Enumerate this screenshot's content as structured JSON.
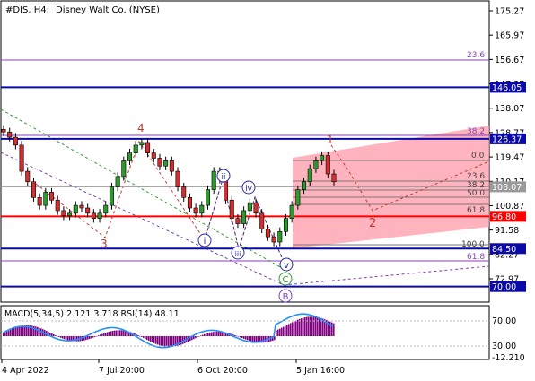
{
  "header": {
    "symbol": "#DIS, H4:",
    "name": "Disney Walt Co. (NYSE)"
  },
  "price_axis": {
    "ticks": [
      "175.27",
      "165.97",
      "156.67",
      "147.37",
      "138.07",
      "128.77",
      "119.47",
      "110.17",
      "100.87",
      "91.58",
      "82.27",
      "72.97"
    ]
  },
  "levels": [
    {
      "value": "146.05",
      "color": "#0a0aa8"
    },
    {
      "value": "126.37",
      "color": "#0a0aa8"
    },
    {
      "value": "108.07",
      "color": "#9a9a9a"
    },
    {
      "value": "96.80",
      "color": "#ff0000"
    },
    {
      "value": "84.50",
      "color": "#0a0aa8"
    },
    {
      "value": "70.00",
      "color": "#0a0aa8"
    }
  ],
  "fib_labels": {
    "top_236": "23.6",
    "left_382": "38.2",
    "f0": "0.0",
    "f236": "23.6",
    "f382": "38.2",
    "f50": "50.0",
    "f618": "61.8",
    "f100": "100.0",
    "f618b": "61.8"
  },
  "wave_labels": {
    "w4": "4",
    "w3": "3",
    "w1": "1",
    "w2": "2",
    "wi": "i",
    "wii": "ii",
    "wiii": "iii",
    "wiv": "iv",
    "wv": "v",
    "wC": "C",
    "wB": "B"
  },
  "indicator": {
    "title": "MACD(5,34,5) 2.121 3.718 RSI(14) 48.11",
    "ticks": [
      "70.00",
      "30.00",
      "-12.210"
    ],
    "macd_color": "#800080",
    "rsi_color": "#1e90ff"
  },
  "time_axis": {
    "ticks": [
      "4 Apr 2022",
      "7 Jul 20:00",
      "6 Oct 20:00",
      "5 Jan 16:00"
    ]
  },
  "chart_data": {
    "type": "line",
    "title": "#DIS, H4: Disney Walt Co. (NYSE)",
    "xlabel": "",
    "ylabel": "",
    "ylim": [
      68,
      178
    ],
    "x_ticks": [
      "4 Apr 2022",
      "7 Jul 20:00",
      "6 Oct 20:00",
      "5 Jan 16:00"
    ],
    "series": [
      {
        "name": "",
        "values": [
          129,
          127,
          124,
          114,
          110,
          104,
          101,
          106,
          103,
          99,
          97,
          98,
          101,
          100,
          98,
          96,
          98,
          101,
          108,
          112,
          118,
          121,
          124,
          125,
          121,
          119,
          116,
          118,
          114,
          108,
          104,
          100,
          98,
          101,
          107,
          114,
          111,
          103,
          96,
          94,
          99,
          102,
          98,
          92,
          89,
          87,
          91,
          96,
          101,
          107,
          110,
          115,
          118,
          120,
          113,
          110
        ]
      }
    ],
    "horizontal_levels": [
      146.05,
      126.37,
      108.07,
      96.8,
      84.5,
      70.0
    ],
    "fibonacci_levels": [
      "0.0",
      "23.6",
      "38.2",
      "50.0",
      "61.8",
      "100.0"
    ],
    "wave_labels": [
      "4",
      "3",
      "1",
      "2",
      "i",
      "ii",
      "iii",
      "iv",
      "v",
      "C",
      "B"
    ],
    "indicator": {
      "name": "MACD(5,34,5) RSI(14)",
      "macd_values": [
        2.121,
        3.718
      ],
      "rsi": 48.11,
      "ticks": [
        70.0,
        30.0,
        -12.21
      ]
    }
  }
}
